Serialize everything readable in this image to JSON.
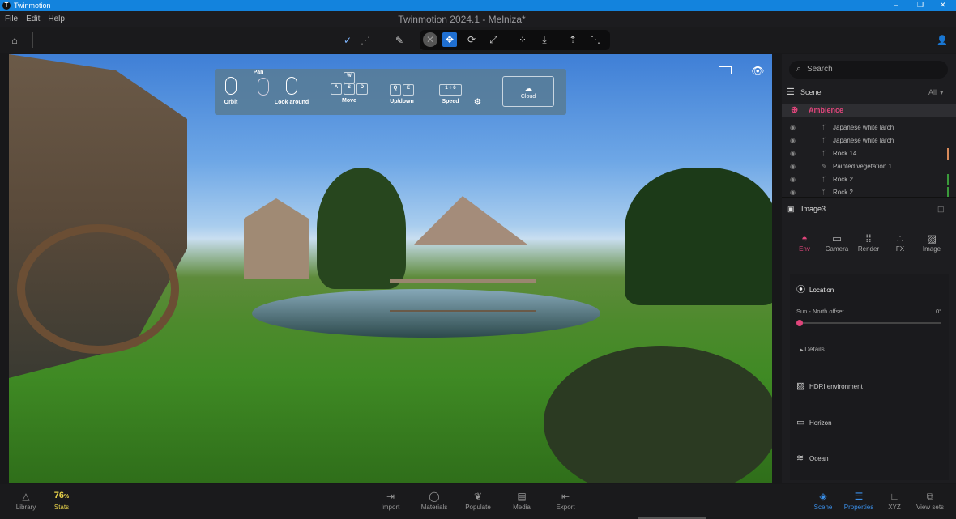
{
  "window": {
    "app_name": "Twinmotion",
    "title": "Twinmotion 2024.1 - Melniza*",
    "minimize": "–",
    "maximize": "❐",
    "close": "✕"
  },
  "menu": [
    "File",
    "Edit",
    "Help"
  ],
  "toolbar": {
    "home": "⌂",
    "check": "✓",
    "grid": "⋰",
    "picker": "✎",
    "cancel": "✕",
    "move": "✥",
    "rotate": "⟳",
    "scale": "⤢",
    "snap": "⁘",
    "drop": "⤓",
    "pivot": "⇡",
    "align": "⋱",
    "user": "👤"
  },
  "nav_overlay": {
    "pan": "Pan",
    "orbit": "Orbit",
    "look_around": "Look around",
    "move": "Move",
    "updown": "Up/down",
    "speed": "Speed",
    "speed_value": "1 ÷ 6",
    "keys": {
      "w": "W",
      "a": "A",
      "s": "S",
      "d": "D",
      "q": "Q",
      "e": "E"
    },
    "cloud": "Cloud"
  },
  "scene": {
    "search_placeholder": "Search",
    "title": "Scene",
    "filter": "All",
    "selected": "Ambience",
    "items": [
      "Japanese white larch",
      "Japanese white larch",
      "Rock 14",
      "Painted vegetation 1",
      "Rock 2",
      "Rock 2"
    ]
  },
  "properties": {
    "title": "Image3",
    "tabs": [
      "Env",
      "Camera",
      "Render",
      "FX",
      "Image"
    ],
    "active_tab": "Env",
    "location": "Location",
    "sun_label": "Sun - North offset",
    "sun_value": "0°",
    "sun_fraction": 0,
    "details": "Details",
    "sections": [
      "HDRI environment",
      "Horizon",
      "Ocean"
    ]
  },
  "accent": "#e0457b",
  "bottom": {
    "library": "Library",
    "stats_value": "76",
    "stats_unit": "%",
    "stats": "Stats",
    "center": [
      "Import",
      "Materials",
      "Populate",
      "Media",
      "Export"
    ],
    "right": [
      "Scene",
      "Properties",
      "XYZ",
      "View sets"
    ]
  }
}
